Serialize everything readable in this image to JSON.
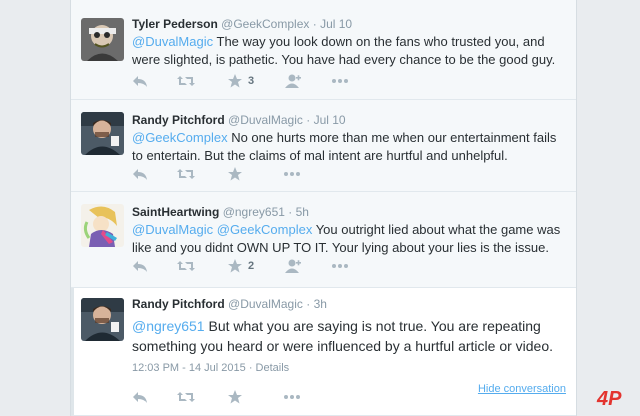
{
  "tweets": [
    {
      "fullname": "Tyler Pederson",
      "username": "@GeekComplex",
      "separator": "·",
      "time": "Jul 10",
      "mention": "@DuvalMagic",
      "text": " The way you look down on the fans who trusted you, and were slighted, is pathetic. You have had every chance to be the good guy.",
      "favorites": "3"
    },
    {
      "fullname": "Randy Pitchford",
      "username": "@DuvalMagic",
      "separator": "·",
      "time": "Jul 10",
      "mention": "@GeekComplex",
      "text": " No one hurts more than me when our entertainment fails to entertain. But the claims of mal intent are hurtful and unhelpful."
    },
    {
      "fullname": "SaintHeartwing",
      "username": "@ngrey651",
      "separator": "·",
      "time": "5h",
      "mention": "@DuvalMagic",
      "mention2": "@GeekComplex",
      "text": " You outright lied about what the game was like and you didnt OWN UP TO IT. Your lying about your lies is the issue.",
      "favorites": "2"
    },
    {
      "fullname": "Randy Pitchford",
      "username": "@DuvalMagic",
      "separator": "·",
      "time": "3h",
      "mention": "@ngrey651",
      "text": " But what you are saying is not true. You are repeating something you heard or were influenced by a hurtful article or video.",
      "timestamp": "12:03 PM - 14 Jul 2015",
      "details_sep": "·",
      "details": "Details"
    }
  ],
  "hide_conversation": "Hide conversation",
  "watermark_text": "4P",
  "icons": {
    "reply": "reply-icon",
    "retweet": "retweet-icon",
    "favorite": "star-icon",
    "follow": "follow-icon",
    "more": "more-icon"
  },
  "colors": {
    "link": "#55acee",
    "muted": "#8899a6",
    "icon": "#aab8c2",
    "background": "#f5f8fa",
    "focused_background": "#ffffff"
  }
}
